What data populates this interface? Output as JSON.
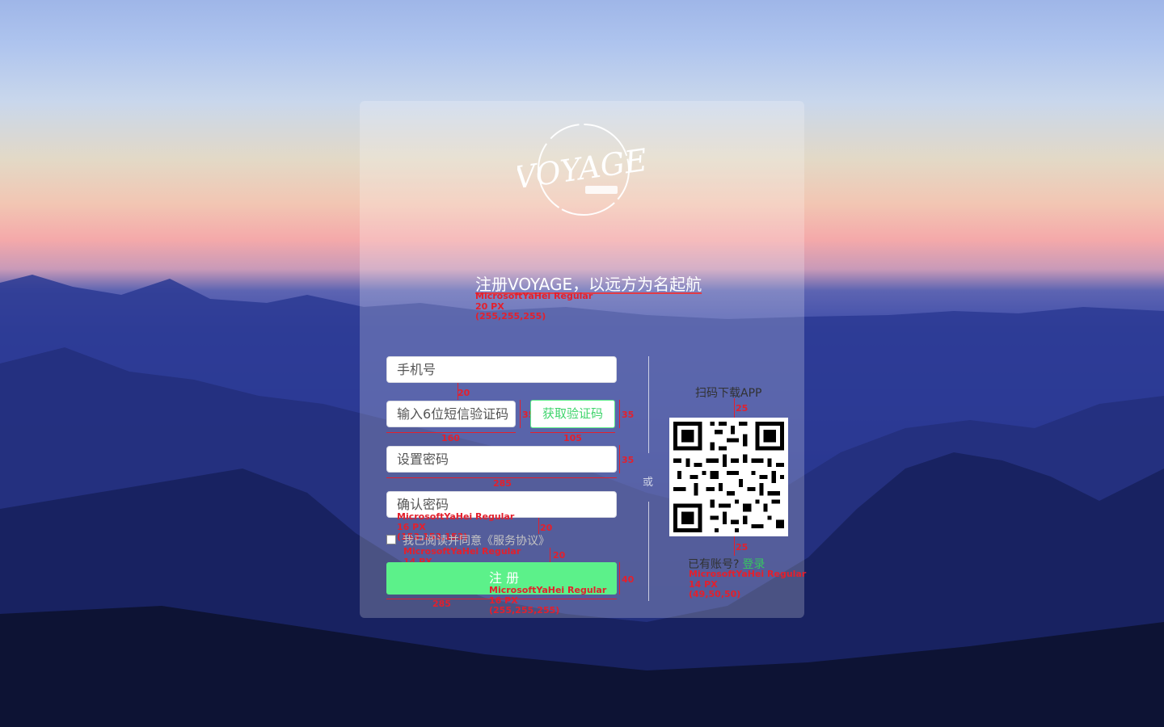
{
  "brand": {
    "logo_text": "VOYAGE"
  },
  "headline": "注册VOYAGE，以远方为名起航",
  "form": {
    "phone_placeholder": "手机号",
    "code_placeholder": "输入6位短信验证码",
    "get_code_label": "获取验证码",
    "password_placeholder": "设置密码",
    "confirm_placeholder": "确认密码",
    "agreement": "我已阅读并同意《服务协议》",
    "register_label": "注 册"
  },
  "divider_text": "或",
  "app_download": {
    "label": "扫码下载APP",
    "has_account": "已有账号?",
    "login_link": "登录"
  },
  "annotations": {
    "headline_font": "MicrosoftYaHei Regular",
    "headline_size": "20 PX",
    "headline_color": "(255,255,255)",
    "gap_20": "20",
    "h_35": "35",
    "w_160": "160",
    "w_105": "105",
    "w_285": "285",
    "input_font": "MicrosoftYaHei Regular",
    "input_size": "16 PX",
    "input_color": "(153,153,153)",
    "agree_font": "MicrosoftYaHei Regular",
    "agree_size": "14 PX",
    "agree_color": "(196,195,195)",
    "h_40": "40",
    "btn_font": "MicrosoftYaHei Regular",
    "btn_size": "16 PX",
    "btn_color": "(255,255,255)",
    "gap_25": "25",
    "acct_font": "MicrosoftYaHei Regular",
    "acct_size": "14 PX",
    "acct_color": "(49,50,50)"
  },
  "colors": {
    "accent_green": "#5cf18a",
    "link_green": "#36c95f",
    "annotation_red": "#e3202d"
  }
}
